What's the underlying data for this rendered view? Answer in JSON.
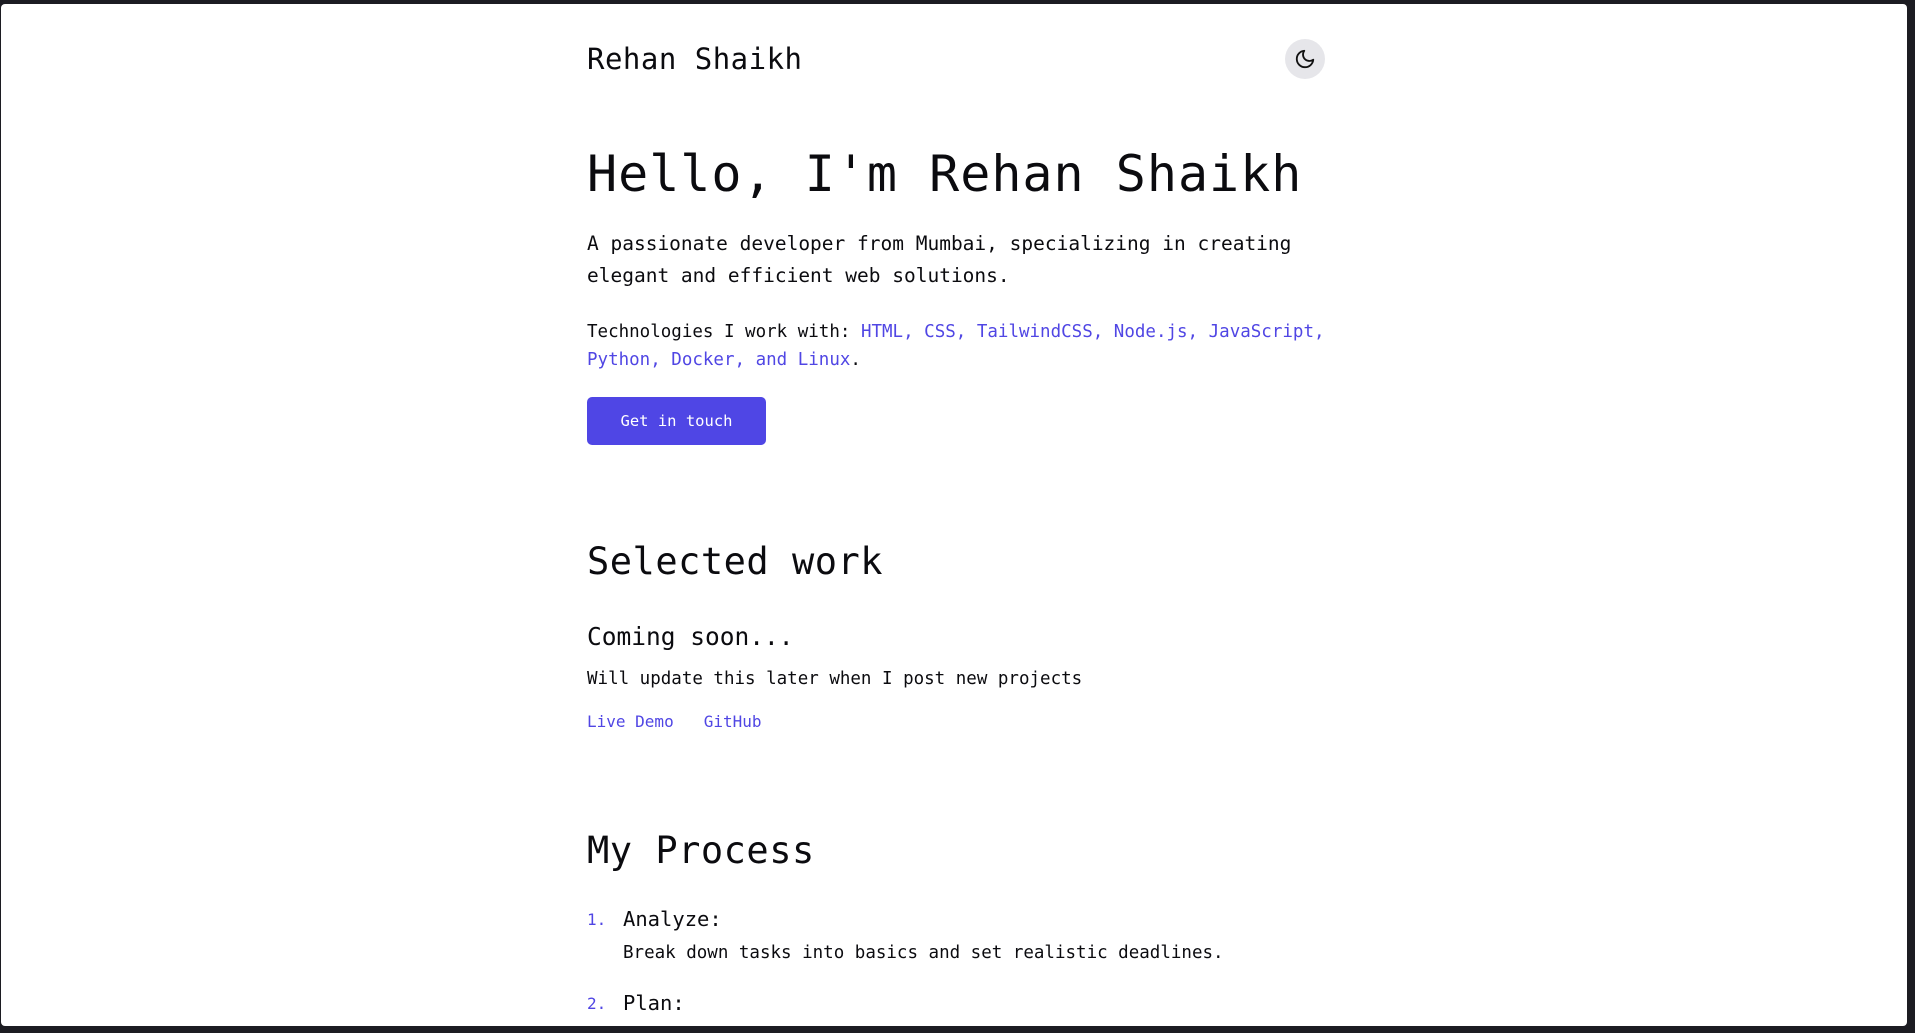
{
  "colors": {
    "accent": "#4f46e5",
    "background": "#ffffff",
    "text": "#0b0b0f",
    "toggle_bg": "#e6e6ea"
  },
  "header": {
    "brand": "Rehan Shaikh",
    "theme_toggle_icon": "moon-icon"
  },
  "hero": {
    "title": "Hello, I'm Rehan Shaikh",
    "description": "A passionate developer from Mumbai, specializing in creating elegant and efficient web solutions.",
    "tech_prefix": "Technologies I work with: ",
    "tech_list": "HTML, CSS, TailwindCSS, Node.js, JavaScript, Python, Docker, and Linux",
    "tech_suffix": ".",
    "cta_label": "Get in touch"
  },
  "work": {
    "title": "Selected work",
    "projects": [
      {
        "title": "Coming soon...",
        "description": "Will update this later when I post new projects",
        "links": [
          "Live Demo",
          "GitHub"
        ]
      }
    ]
  },
  "process": {
    "title": "My Process",
    "steps": [
      {
        "number": "1.",
        "title": "Analyze:",
        "description": "Break down tasks into basics and set realistic deadlines."
      },
      {
        "number": "2.",
        "title": "Plan:",
        "description": ""
      }
    ]
  }
}
